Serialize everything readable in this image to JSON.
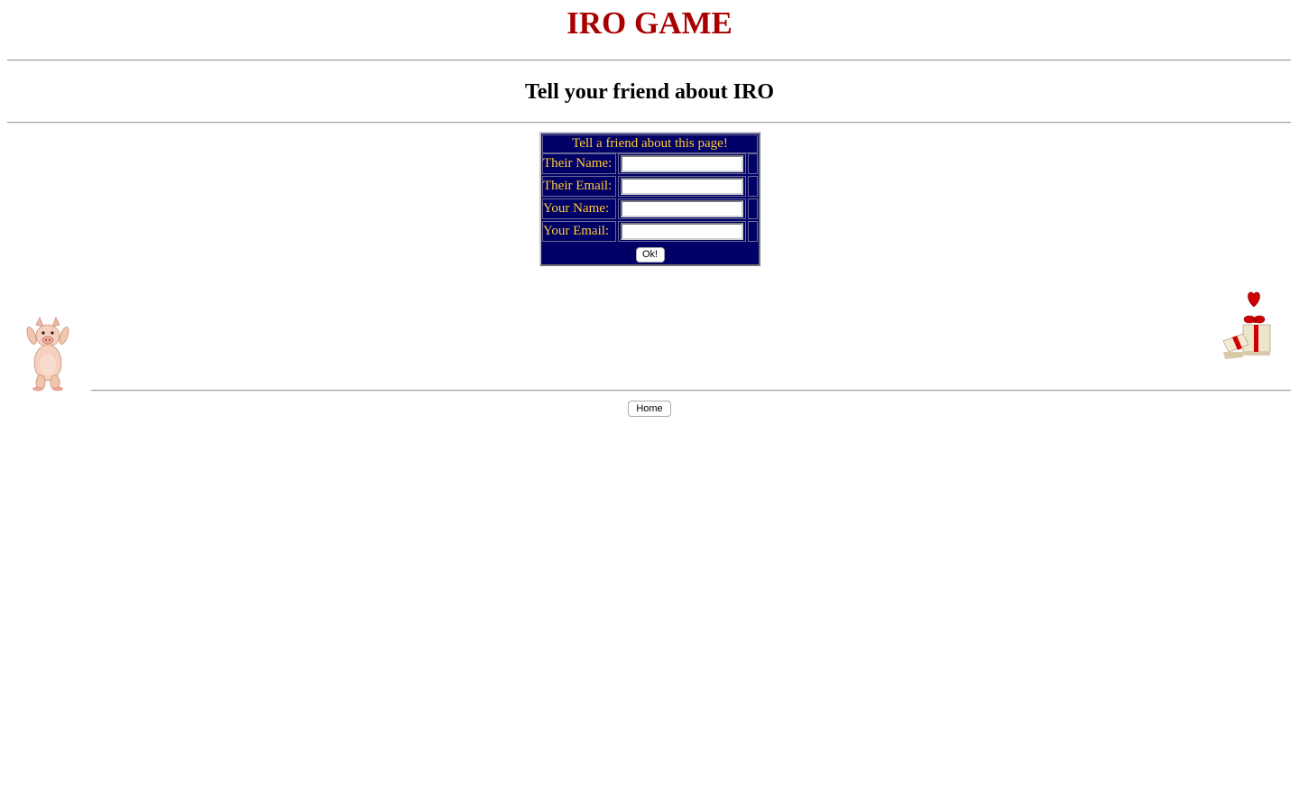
{
  "site": {
    "title": "IRO GAME",
    "heading": "Tell your friend about IRO"
  },
  "form": {
    "header": "Tell a friend about this page!",
    "fields": [
      {
        "label": "Their Name:",
        "value": "",
        "placeholder": ""
      },
      {
        "label": "Their Email:",
        "value": "",
        "placeholder": ""
      },
      {
        "label": "Your Name:",
        "value": "",
        "placeholder": ""
      },
      {
        "label": "Your Email:",
        "value": "",
        "placeholder": ""
      }
    ],
    "submit_label": "Ok!"
  },
  "nav": {
    "home_label": "Home"
  },
  "decor": {
    "left_image": "dancing-pig-icon",
    "right_image": "gift-box-heart-icon"
  },
  "colors": {
    "title": "#a80000",
    "form_bg": "#000066",
    "form_text": "#ffcc33"
  }
}
